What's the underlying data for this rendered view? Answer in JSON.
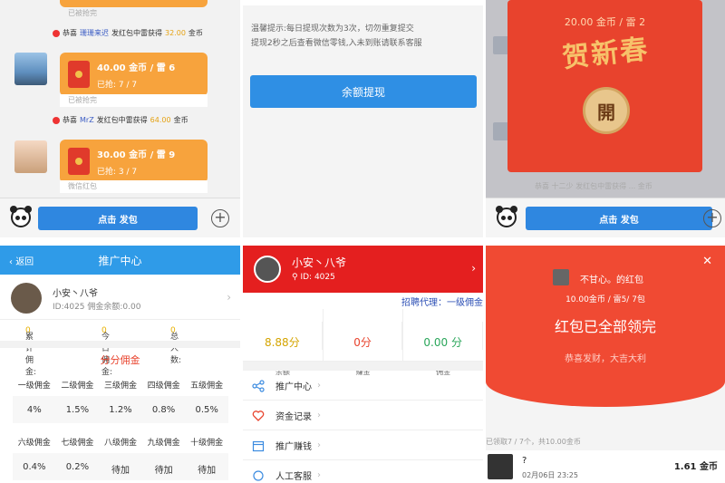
{
  "chat": {
    "notes": {
      "top": "已被抢完",
      "mid": "已被抢完"
    },
    "sys1": {
      "prefix": "恭喜",
      "name": "珊珊来迟",
      "mid": "发红包中雷获得",
      "amount": "32.00",
      "unit": "金币"
    },
    "packet1": {
      "title": "40.00 金币 / 雷 6",
      "grabbed": "已抢: 7 / 7"
    },
    "sys2": {
      "prefix": "恭喜",
      "name": "MrZ",
      "mid": "发红包中雷获得",
      "amount": "64.00",
      "unit": "金币"
    },
    "packet2": {
      "title": "30.00 金币 / 雷 9",
      "grabbed": "已抢: 3 / 7",
      "foot": "微信红包"
    },
    "send_label": "点击 发包"
  },
  "withdraw": {
    "tip_line1": "温馨提示:每日提现次数为3次，切勿重复提交",
    "tip_line2": "提现2秒之后查看微信零钱,入未到账请联系客服",
    "button": "余额提现"
  },
  "open_packet": {
    "title": "20.00 金币 / 雷 2",
    "art_text": "贺新春",
    "open_label": "開",
    "foot": "恭喜 十二少 发红包中雷获得 ... 金币",
    "send_label": "点击 发包"
  },
  "promo": {
    "back": "返回",
    "title": "推广中心",
    "user_name": "小安丶八爷",
    "user_id": "ID:4025 佣金余额:0.00",
    "stats": {
      "total_label": "累计佣金:",
      "total": "0",
      "today_label": "今日佣金:",
      "today": "0",
      "people_label": "总人数:",
      "people": "0"
    },
    "section": "分分佣金",
    "levels_row1": [
      "一级佣金",
      "二级佣金",
      "三级佣金",
      "四级佣金",
      "五级佣金"
    ],
    "rates_row1": [
      "4%",
      "1.5%",
      "1.2%",
      "0.8%",
      "0.5%"
    ],
    "levels_row2": [
      "六级佣金",
      "七级佣金",
      "八级佣金",
      "九级佣金",
      "十级佣金"
    ],
    "rates_row2": [
      "0.4%",
      "0.2%",
      "待加",
      "待加",
      "待加"
    ]
  },
  "profile": {
    "name": "小安丶八爷",
    "id": "ID: 4025",
    "recruit": "招聘代理：一级佣金",
    "stats": [
      {
        "value": "8.88分",
        "label": "余额",
        "color": "#d4a400"
      },
      {
        "value": "0分",
        "label": "赚金",
        "color": "#e8432d"
      },
      {
        "value": "0.00 分",
        "label": "佣金",
        "color": "#2aa65a"
      }
    ],
    "menu": [
      "推广中心",
      "资金记录",
      "推广赚钱",
      "人工客服"
    ]
  },
  "result": {
    "from": "不甘心。的红包",
    "info": "10.00金币 / 雷5/ 7包",
    "done": "红包已全部领完",
    "wish": "恭喜发财，大吉大利",
    "summary": "已领取7 / 7个，共10.00金币",
    "row": {
      "name": "?",
      "date": "02月06日",
      "time": "23:25",
      "amount": "1.61",
      "unit": "金币"
    }
  }
}
